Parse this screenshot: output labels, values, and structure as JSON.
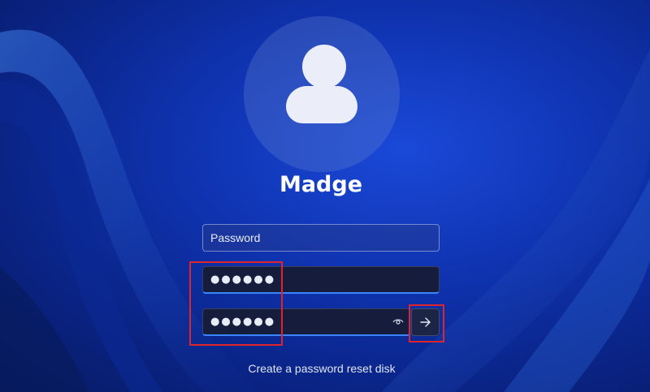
{
  "user": {
    "name": "Madge"
  },
  "form": {
    "hint_field_value": "Password",
    "password_field_value": "●●●●●●",
    "confirm_field_value": "●●●●●●",
    "submit_icon": "arrow-right-icon",
    "reveal_icon": "eye-icon"
  },
  "links": {
    "reset_disk": "Create a password reset disk"
  },
  "colors": {
    "background": "#0f33b0",
    "field_background": "#161d3c",
    "field_accent": "#3a86ff",
    "annotation_red": "#e0242b"
  }
}
